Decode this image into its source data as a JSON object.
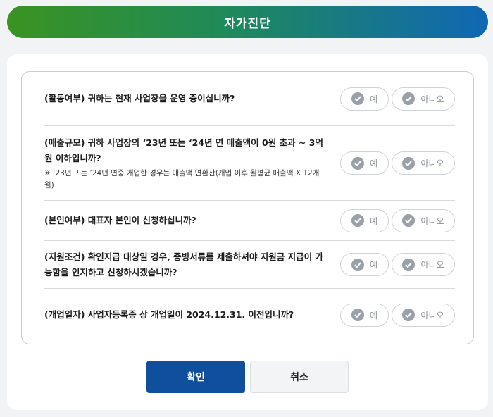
{
  "title": "자가진단",
  "option_labels": {
    "yes": "예",
    "no": "아니오"
  },
  "questions": [
    {
      "text": "(활동여부) 귀하는 현재 사업장을 운영 중이십니까?",
      "note": ""
    },
    {
      "text": "(매출규모) 귀하 사업장의 ‘23년 또는 ‘24년 연 매출액이 0원 초과 ~ 3억원 이하입니까?",
      "note": "※ ‘23년 또는 ’24년 연중 개업한 경우는 매출액 연환산(개업 이후 월평균 매출액 X 12개월)"
    },
    {
      "text": "(본인여부) 대표자 본인이 신청하십니까?",
      "note": ""
    },
    {
      "text": "(지원조건) 확인지급 대상일 경우, 증빙서류를 제출하셔야 지원금 지급이 가능함을 인지하고 신청하시겠습니까?",
      "note": ""
    },
    {
      "text": "(개업일자) 사업자등록증 상 개업일이 2024.12.31. 이전입니까?",
      "note": ""
    }
  ],
  "buttons": {
    "confirm": "확인",
    "cancel": "취소"
  }
}
